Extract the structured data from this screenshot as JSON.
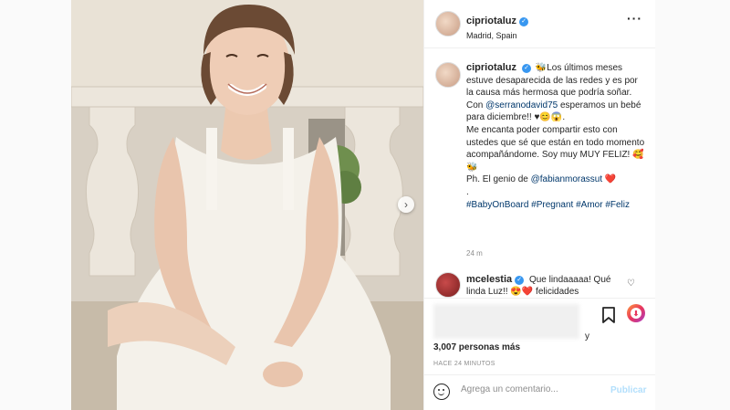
{
  "post": {
    "username": "cipriotaluz",
    "location": "Madrid, Spain",
    "more_icon": "more-options-icon",
    "caption": {
      "username": "cipriotaluz",
      "line1": "🐝Los últimos meses estuve desaparecida de las redes y es por la causa más hermosa que podría soñar.",
      "line2_pre": "Con ",
      "mention1": "@serranodavid75",
      "line2_post": " esperamos un bebé para diciembre!! ♥😊😱.",
      "line3": "Me encanta poder compartir esto con ustedes que sé que están en todo momento acompañándome. Soy muy MUY FELIZ! 🥰🐝",
      "line4_pre": "Ph. El genio de ",
      "mention2": "@fabianmorassut",
      "line4_post": " ❤️",
      "dot": ".",
      "hashtags": "#BabyOnBoard #Pregnant #Amor #Feliz"
    },
    "caption_time": "24 m",
    "comment": {
      "username": "mcelestia",
      "text": "Que lindaaaaa! Qué linda Luz!! 😍❤️ felicidades"
    },
    "likes_suffix": "y",
    "likes_count": "3,007 personas más",
    "timestamp": "HACE 24 MINUTOS",
    "comment_input": {
      "placeholder": "Agrega un comentario...",
      "post_label": "Publicar"
    }
  },
  "colors": {
    "link": "#00376b",
    "verified": "#3897f0",
    "muted": "#8e8e8e",
    "post_disabled": "#b2dffc"
  }
}
